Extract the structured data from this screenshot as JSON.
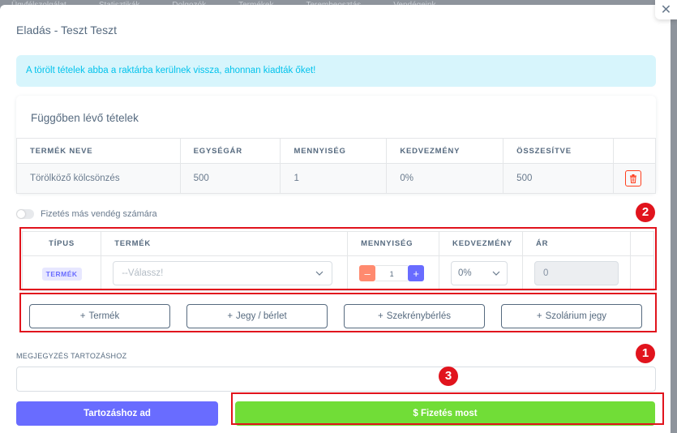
{
  "background": {
    "nav_items": [
      "Ügyfélszolgálat",
      "Statisztikák",
      "Dolgozók",
      "Termékek",
      "Terembeosztás",
      "Vendégeink"
    ]
  },
  "modal": {
    "title": "Eladás - Teszt Teszt",
    "alert": "A törölt tételek abba a raktárba kerülnek vissza, ahonnan kiadták őket!"
  },
  "pending": {
    "title": "Függőben lévő tételek",
    "columns": [
      "TERMÉK NEVE",
      "EGYSÉGÁR",
      "MENNYISÉG",
      "KEDVEZMÉNY",
      "ÖSSZESÍTVE"
    ],
    "rows": [
      {
        "name": "Törölköző kölcsönzés",
        "unit_price": "500",
        "quantity": "1",
        "discount": "0%",
        "total": "500"
      }
    ]
  },
  "toggle": {
    "label": "Fizetés más vendég számára"
  },
  "items": {
    "columns": [
      "TÍPUS",
      "TERMÉK",
      "MENNYISÉG",
      "KEDVEZMÉNY",
      "ÁR"
    ],
    "row": {
      "type_badge": "TERMÉK",
      "product_placeholder": "--Válassz!",
      "quantity": "1",
      "discount": "0%",
      "price": "0"
    }
  },
  "add_buttons": [
    "Termék",
    "Jegy / bérlet",
    "Szekrénybérlés",
    "Szolárium jegy"
  ],
  "note": {
    "label": "MEGJEGYZÉS TARTOZÁSHOZ",
    "value": ""
  },
  "actions": {
    "debt_label": "Tartozáshoz ad",
    "pay_label": "$ Fizetés most"
  },
  "annotations": {
    "marker_1": "1",
    "marker_2": "2",
    "marker_3": "3"
  },
  "colors": {
    "primary": "#696cff",
    "success": "#71dd37",
    "danger": "#ff3e1d",
    "info": "#03c3ec",
    "highlight": "#e1141d"
  }
}
